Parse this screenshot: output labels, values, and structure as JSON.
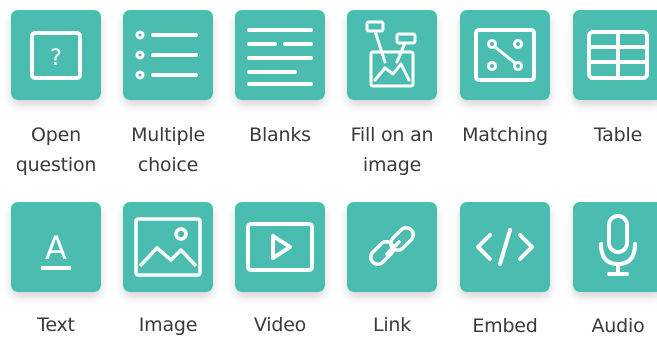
{
  "theme": {
    "tile_color": "#4bbdb0",
    "icon_color": "#ffffff",
    "label_color": "#3a3a3a"
  },
  "blocks": [
    {
      "id": "open-question",
      "icon": "question-box-icon",
      "label_lines": [
        "Open",
        "question"
      ]
    },
    {
      "id": "multiple-choice",
      "icon": "bulleted-list-icon",
      "label_lines": [
        "Multiple",
        "choice"
      ]
    },
    {
      "id": "blanks",
      "icon": "blank-lines-icon",
      "label_lines": [
        "Blanks"
      ]
    },
    {
      "id": "fill-on-image",
      "icon": "image-labels-icon",
      "label_lines": [
        "Fill on an",
        "image"
      ]
    },
    {
      "id": "matching",
      "icon": "matching-dots-icon",
      "label_lines": [
        "Matching"
      ]
    },
    {
      "id": "table",
      "icon": "table-grid-icon",
      "label_lines": [
        "Table"
      ]
    },
    {
      "id": "text",
      "icon": "text-letter-icon",
      "label_lines": [
        "Text"
      ]
    },
    {
      "id": "image",
      "icon": "image-icon",
      "label_lines": [
        "Image"
      ]
    },
    {
      "id": "video",
      "icon": "video-play-icon",
      "label_lines": [
        "Video"
      ]
    },
    {
      "id": "link",
      "icon": "chain-link-icon",
      "label_lines": [
        "Link"
      ]
    },
    {
      "id": "embed",
      "icon": "code-brackets-icon",
      "label_lines": [
        "Embed"
      ]
    },
    {
      "id": "audio",
      "icon": "microphone-icon",
      "label_lines": [
        "Audio"
      ]
    }
  ]
}
